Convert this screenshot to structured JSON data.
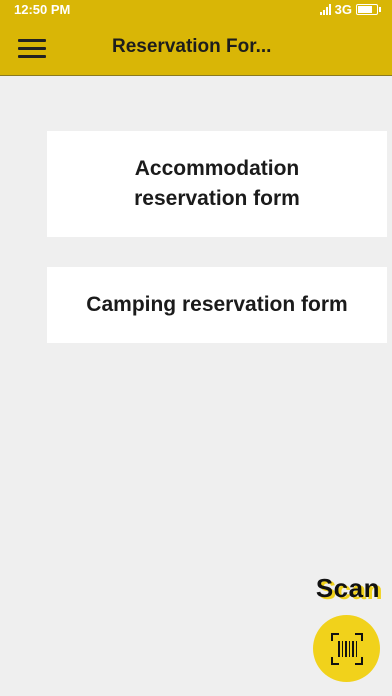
{
  "status_bar": {
    "time": "12:50 PM",
    "network": "3G",
    "icons": [
      "signal-icon",
      "battery-icon"
    ]
  },
  "app_bar": {
    "title": "Reservation For...",
    "menu_icon": "hamburger-menu-icon",
    "color": "#d9b606"
  },
  "forms": [
    {
      "label": "Accommodation reservation form"
    },
    {
      "label": "Camping reservation form"
    }
  ],
  "scan": {
    "label": "Scan",
    "icon": "barcode-scan-icon",
    "color": "#f1d21b"
  }
}
